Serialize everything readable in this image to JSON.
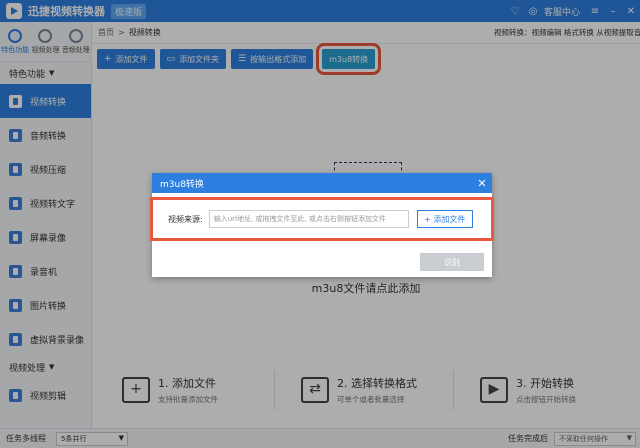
{
  "titlebar": {
    "app_title": "迅捷视频转换器",
    "version_badge": "极速版",
    "support_label": "客服中心",
    "icons": [
      "heart-icon",
      "support-icon",
      "settings-icon",
      "minimize-icon",
      "close-icon"
    ]
  },
  "sidebar": {
    "topnav": [
      {
        "label": "特色功能",
        "active": true
      },
      {
        "label": "视频处理",
        "active": false
      },
      {
        "label": "音频处理",
        "active": false
      }
    ],
    "section1_title": "特色功能",
    "items": [
      {
        "label": "视频转换",
        "active": true
      },
      {
        "label": "音频转换"
      },
      {
        "label": "视频压缩"
      },
      {
        "label": "视频转文字"
      },
      {
        "label": "屏幕录像"
      },
      {
        "label": "录音机"
      },
      {
        "label": "图片转换"
      },
      {
        "label": "虚拟背景录像"
      }
    ],
    "section2_title": "视频处理",
    "items2": [
      {
        "label": "视频剪辑"
      }
    ]
  },
  "breadcrumb": {
    "home": "首页",
    "separator": ">",
    "current": "视频转换"
  },
  "tips": "视频转换：视频编辑 格式转换 从视频提取音频",
  "toolbar": {
    "add_file": "添加文件",
    "add_folder": "添加文件夹",
    "add_by_format": "按输出格式添加",
    "m3u8": "m3u8转换"
  },
  "drop_area_text": "m3u8文件请点此添加",
  "steps": [
    {
      "title": "1. 添加文件",
      "desc": "支持批量添加文件"
    },
    {
      "title": "2. 选择转换格式",
      "desc": "可单个或者批量选择"
    },
    {
      "title": "3. 开始转换",
      "desc": "点击按钮开始转换"
    }
  ],
  "statusbar": {
    "multithread_label": "任务多线程",
    "parallel_value": "5条并行",
    "done_label": "任务完成后",
    "after_value": "不采取任何操作"
  },
  "dialog": {
    "title": "m3u8转换",
    "source_label": "视频来源:",
    "input_placeholder": "输入url地址, 或拖拽文件至此, 或点击右侧按钮添加文件",
    "add_file_button": "+ 添加文件",
    "identify_button": "识别"
  },
  "colors": {
    "accent": "#2d7fe0",
    "highlight": "#e8593e"
  }
}
